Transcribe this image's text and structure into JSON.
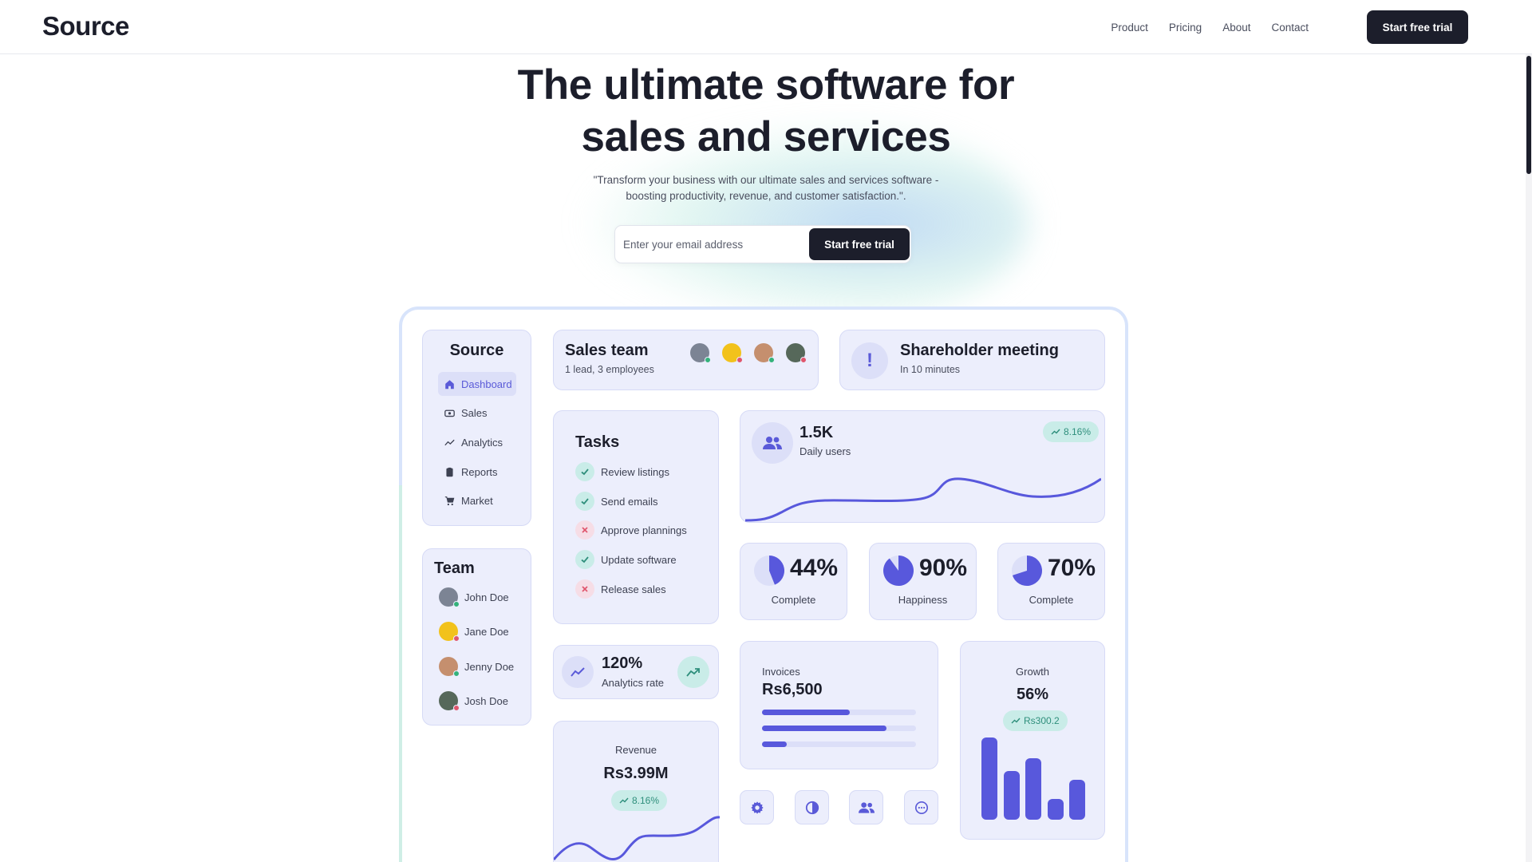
{
  "header": {
    "logo": "Source",
    "nav": [
      "Product",
      "Pricing",
      "About",
      "Contact"
    ],
    "cta": "Start free trial"
  },
  "hero": {
    "title_line1": "The ultimate software for",
    "title_line2": "sales and services",
    "subtitle_line1": "\"Transform your business with our ultimate sales and services software -",
    "subtitle_line2": "boosting productivity, revenue, and customer satisfaction.\".",
    "email_placeholder": "Enter your email address",
    "email_cta": "Start free trial"
  },
  "dashboard": {
    "sidebar": {
      "title": "Source",
      "items": [
        {
          "label": "Dashboard",
          "icon": "home-icon",
          "active": true
        },
        {
          "label": "Sales",
          "icon": "sales-icon",
          "active": false
        },
        {
          "label": "Analytics",
          "icon": "trend-icon",
          "active": false
        },
        {
          "label": "Reports",
          "icon": "clipboard-icon",
          "active": false
        },
        {
          "label": "Market",
          "icon": "cart-icon",
          "active": false
        }
      ]
    },
    "team": {
      "title": "Team",
      "members": [
        {
          "name": "John Doe",
          "status": "online"
        },
        {
          "name": "Jane Doe",
          "status": "away"
        },
        {
          "name": "Jenny Doe",
          "status": "online"
        },
        {
          "name": "Josh Doe",
          "status": "busy"
        }
      ]
    },
    "sales_team": {
      "title": "Sales team",
      "subtitle": "1 lead, 3 employees"
    },
    "meeting": {
      "title": "Shareholder meeting",
      "subtitle": "In 10 minutes",
      "icon": "exclamation-icon"
    },
    "tasks": {
      "title": "Tasks",
      "items": [
        {
          "label": "Review listings",
          "done": true
        },
        {
          "label": "Send emails",
          "done": true
        },
        {
          "label": "Approve plannings",
          "done": false
        },
        {
          "label": "Update software",
          "done": true
        },
        {
          "label": "Release sales",
          "done": false
        }
      ]
    },
    "daily_users": {
      "value": "1.5K",
      "label": "Daily users",
      "change": "8.16%"
    },
    "stats": [
      {
        "value": "44%",
        "label": "Complete",
        "fraction": 0.44
      },
      {
        "value": "90%",
        "label": "Happiness",
        "fraction": 0.9
      },
      {
        "value": "70%",
        "label": "Complete",
        "fraction": 0.7
      }
    ],
    "analytics": {
      "value": "120%",
      "label": "Analytics rate"
    },
    "invoices": {
      "label": "Invoices",
      "value": "Rs6,500",
      "bars": [
        0.57,
        0.81,
        0.16
      ]
    },
    "growth": {
      "label": "Growth",
      "value": "56%",
      "change": "Rs300.2",
      "bars": [
        1.0,
        0.59,
        0.75,
        0.25,
        0.49
      ]
    },
    "revenue": {
      "label": "Revenue",
      "value": "Rs3.99M",
      "change": "8.16%"
    },
    "colors": {
      "accent": "#5858dc",
      "card": "#eceefc",
      "positive": "#2f8f7c",
      "negative": "#e0566d",
      "dark": "#1c1e2b"
    }
  }
}
